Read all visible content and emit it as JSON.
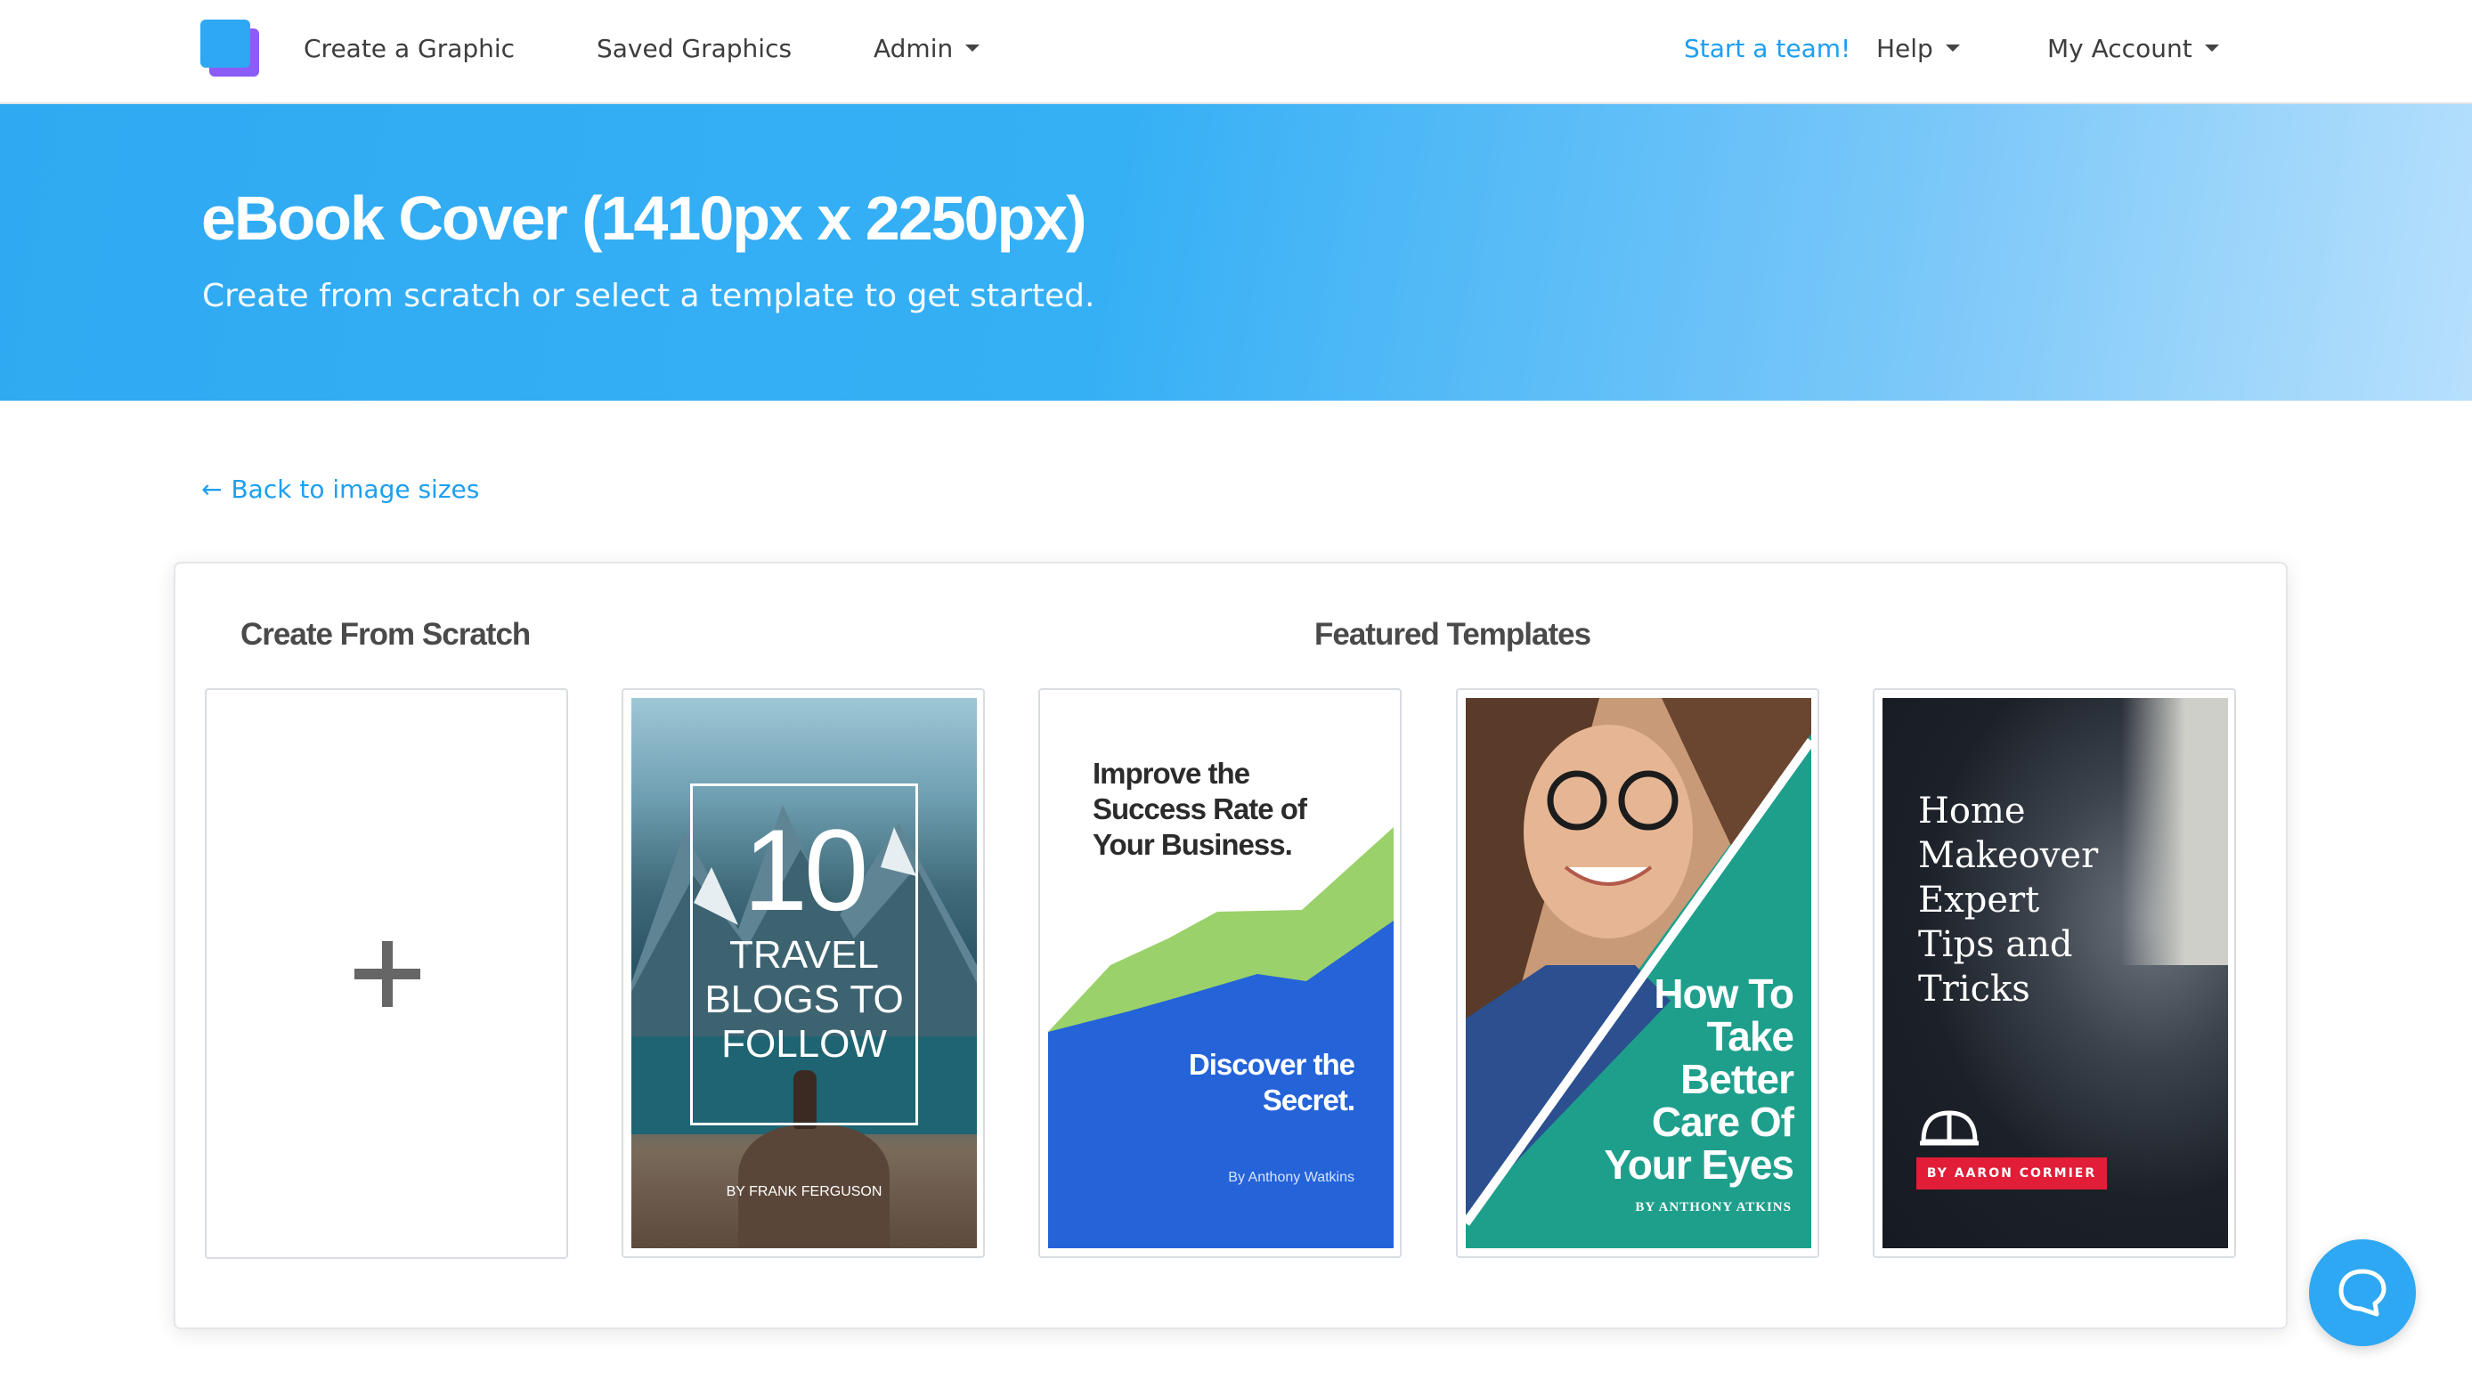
{
  "nav": {
    "logo": "app-logo-icon",
    "create": "Create a Graphic",
    "saved": "Saved Graphics",
    "admin": "Admin",
    "start_team": "Start a team!",
    "help": "Help",
    "account": "My Account"
  },
  "hero": {
    "title": "eBook Cover (1410px x 2250px)",
    "subtitle": "Create from scratch or select a template to get started."
  },
  "back_link": {
    "arrow": "←",
    "label": "Back to image sizes"
  },
  "sections": {
    "scratch_title": "Create From Scratch",
    "featured_title": "Featured Templates"
  },
  "templates": [
    {
      "number": "10",
      "title_lines": [
        "TRAVEL",
        "BLOGS TO",
        "FOLLOW"
      ],
      "author": "BY FRANK FERGUSON"
    },
    {
      "headline_lines": [
        "Improve the",
        "Success Rate of",
        "Your Business."
      ],
      "tagline_lines": [
        "Discover the",
        "Secret."
      ],
      "author": "By Anthony Watkins"
    },
    {
      "title_lines": [
        "How To",
        "Take",
        "Better",
        "Care Of",
        "Your Eyes"
      ],
      "author": "BY ANTHONY ATKINS"
    },
    {
      "title_lines": [
        "Home",
        "Makeover",
        "Expert",
        "Tips and",
        "Tricks"
      ],
      "author": "BY AARON CORMIER"
    }
  ],
  "colors": {
    "accent": "#2ea8f2",
    "link": "#1d9ff0",
    "business_green": "#9ad16a",
    "business_blue": "#2563d9",
    "eyes_teal": "#1ea594",
    "home_badge_red": "#e11d37"
  },
  "chat": {
    "icon": "chat-bubble-icon"
  }
}
